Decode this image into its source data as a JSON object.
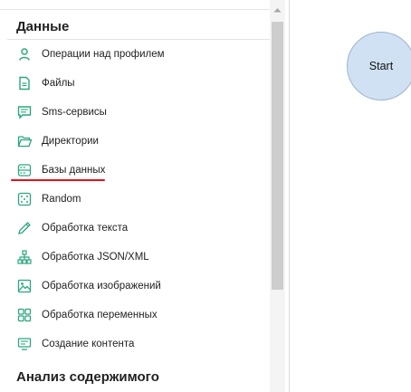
{
  "sidebar": {
    "sections": [
      {
        "title": "Данные",
        "items": [
          {
            "label": "Операции над профилем",
            "icon": "user-profile-icon"
          },
          {
            "label": "Файлы",
            "icon": "file-icon"
          },
          {
            "label": "Sms-сервисы",
            "icon": "sms-chat-icon"
          },
          {
            "label": "Директории",
            "icon": "folder-icon"
          },
          {
            "label": "Базы данных",
            "icon": "database-icon"
          },
          {
            "label": "Random",
            "icon": "dice-icon"
          },
          {
            "label": "Обработка текста",
            "icon": "pencil-icon"
          },
          {
            "label": "Обработка JSON/XML",
            "icon": "tree-structure-icon"
          },
          {
            "label": "Обработка изображений",
            "icon": "image-icon"
          },
          {
            "label": "Обработка переменных",
            "icon": "variables-grid-icon"
          },
          {
            "label": "Создание контента",
            "icon": "content-create-icon"
          }
        ]
      },
      {
        "title": "Анализ содержимого",
        "items": []
      }
    ],
    "highlighted_item": "Базы данных",
    "highlight_color": "#e0141b",
    "icon_color": "#2aa67e"
  },
  "canvas": {
    "start_node": {
      "label": "Start",
      "fill": "#cfe1f3"
    }
  }
}
